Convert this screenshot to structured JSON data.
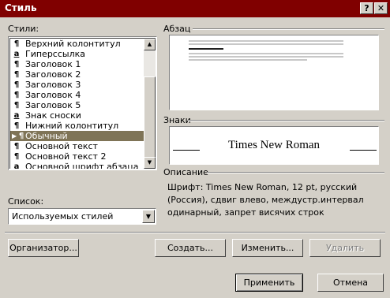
{
  "window": {
    "title": "Стиль",
    "help_label": "?",
    "close_label": "✕"
  },
  "styles_label": "Стили:",
  "styles": [
    {
      "mark": "¶",
      "type": "para",
      "label": "Верхний колонтитул",
      "selected": false
    },
    {
      "mark": "a",
      "type": "char",
      "label": "Гиперссылка",
      "selected": false
    },
    {
      "mark": "¶",
      "type": "para",
      "label": "Заголовок 1",
      "selected": false
    },
    {
      "mark": "¶",
      "type": "para",
      "label": "Заголовок 2",
      "selected": false
    },
    {
      "mark": "¶",
      "type": "para",
      "label": "Заголовок 3",
      "selected": false
    },
    {
      "mark": "¶",
      "type": "para",
      "label": "Заголовок 4",
      "selected": false
    },
    {
      "mark": "¶",
      "type": "para",
      "label": "Заголовок 5",
      "selected": false
    },
    {
      "mark": "a",
      "type": "char",
      "label": "Знак сноски",
      "selected": false
    },
    {
      "mark": "¶",
      "type": "para",
      "label": "Нижний колонтитул",
      "selected": false
    },
    {
      "mark": "¶",
      "type": "para",
      "label": "Обычный",
      "selected": true
    },
    {
      "mark": "¶",
      "type": "para",
      "label": "Основной текст",
      "selected": false
    },
    {
      "mark": "¶",
      "type": "para",
      "label": "Основной текст 2",
      "selected": false
    },
    {
      "mark": "a",
      "type": "char",
      "label": "Основной шрифт абзаца",
      "selected": false
    }
  ],
  "list_label": "Список:",
  "list_value": "Используемых стилей",
  "paragraph_label": "Абзац",
  "chars_label": "Знаки",
  "font_sample": "Times New Roman",
  "description_label": "Описание",
  "description": "Шрифт: Times New Roman, 12 pt, русский (Россия), сдвиг влево, междустр.интервал одинарный, запрет висячих строк",
  "buttons": {
    "organizer": "Организатор...",
    "create": "Создать...",
    "modify": "Изменить...",
    "delete": "Удалить",
    "apply": "Применить",
    "cancel": "Отмена"
  },
  "colors": {
    "titlebar": "#800000",
    "selection": "#7f7457",
    "face": "#d4d0c8"
  }
}
